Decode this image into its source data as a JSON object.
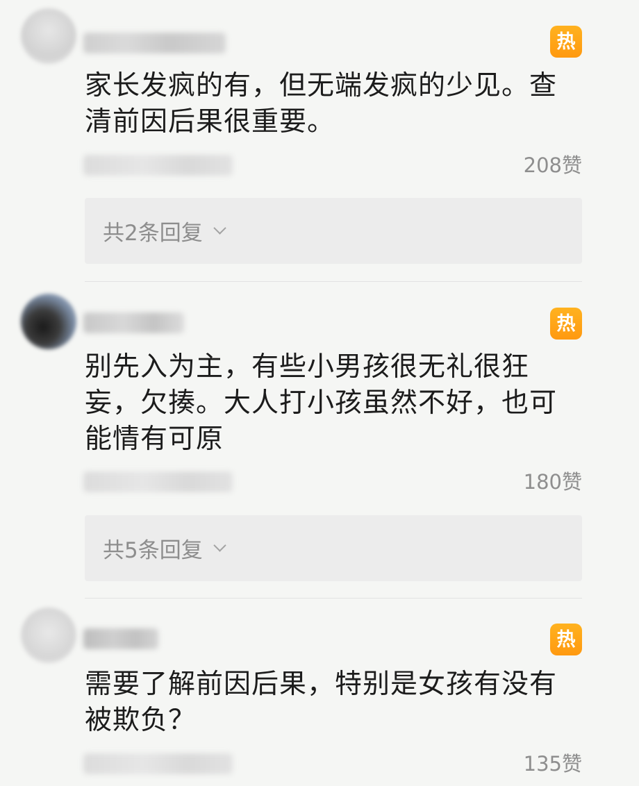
{
  "comments": [
    {
      "hot_label": "热",
      "content": "家长发疯的有，但无端发疯的少见。查清前因后果很重要。",
      "likes": "208赞",
      "replies_label": "共2条回复"
    },
    {
      "hot_label": "热",
      "content": "别先入为主，有些小男孩很无礼很狂妄，欠揍。大人打小孩虽然不好，也可能情有可原",
      "likes": "180赞",
      "replies_label": "共5条回复"
    },
    {
      "hot_label": "热",
      "content": "需要了解前因后果，特别是女孩有没有被欺负？",
      "likes": "135赞"
    }
  ],
  "colors": {
    "hot_badge": "#ffa515",
    "likes_text": "#8e8e8e",
    "reply_box": "#ececec",
    "background": "#f5f6f4"
  },
  "icons": {
    "replies_expand": "chevron-down-icon"
  }
}
